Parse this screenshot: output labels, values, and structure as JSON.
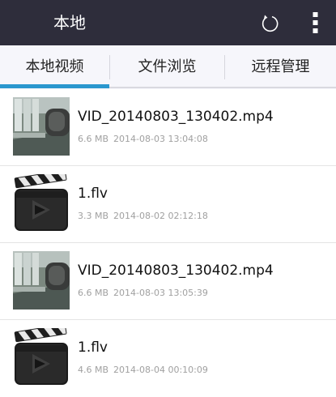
{
  "appbar": {
    "title": "本地",
    "refresh_icon": "refresh-icon",
    "more_icon": "more-vert-icon",
    "background": "#2e2d3b"
  },
  "tabs": [
    {
      "label": "本地视频",
      "selected": true
    },
    {
      "label": "文件浏览",
      "selected": false
    },
    {
      "label": "远程管理",
      "selected": false
    }
  ],
  "accent": "#2a97ce",
  "files": [
    {
      "name": "VID_20140803_130402.mp4",
      "size": "6.6 MB",
      "date": "2014-08-03 13:04:08",
      "thumb": "video-frame-thumbnail"
    },
    {
      "name": "1.flv",
      "size": "3.3 MB",
      "date": "2014-08-02 02:12:18",
      "thumb": "clapperboard-icon"
    },
    {
      "name": "VID_20140803_130402.mp4",
      "size": "6.6 MB",
      "date": "2014-08-03 13:05:39",
      "thumb": "video-frame-thumbnail"
    },
    {
      "name": "1.flv",
      "size": "4.6 MB",
      "date": "2014-08-04 00:10:09",
      "thumb": "clapperboard-icon"
    }
  ]
}
